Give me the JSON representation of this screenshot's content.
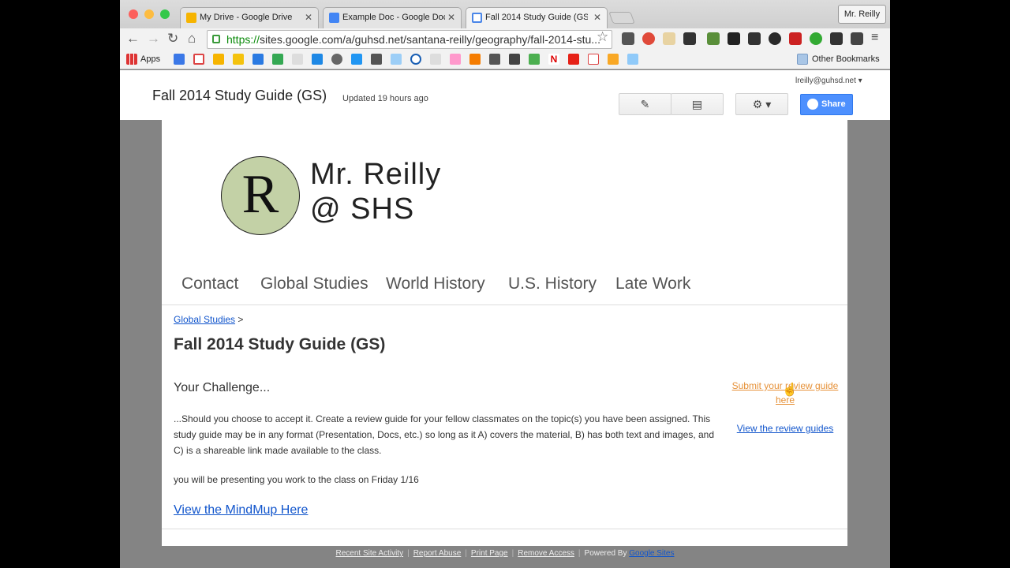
{
  "browser": {
    "tabs": [
      {
        "title": "My Drive - Google Drive",
        "icon": "google-drive-icon",
        "color": "#f6b400"
      },
      {
        "title": "Example Doc - Google Docs",
        "icon": "google-docs-icon",
        "color": "#4285f4"
      },
      {
        "title": "Fall 2014 Study Guide (GS)",
        "icon": "google-sites-icon",
        "color": "#4a86e8"
      }
    ],
    "profile_label": "Mr. Reilly",
    "url_scheme": "https://",
    "url_rest": "sites.google.com/a/guhsd.net/santana-reilly/geography/fall-2014-stu...",
    "bookmarks": {
      "apps_label": "Apps",
      "other_label": "Other Bookmarks"
    }
  },
  "site_header": {
    "title": "Fall 2014 Study Guide (GS)",
    "updated": "Updated 19 hours ago",
    "account": "lreilly@guhsd.net",
    "share_label": "Share",
    "share_color": "#4d90fe"
  },
  "logo": {
    "letter": "R",
    "line1": "Mr. Reilly",
    "line2": "@ SHS",
    "circle_color": "#c3d1a6"
  },
  "nav": [
    "Contact",
    "Global Studies",
    "World History",
    "U.S. History",
    "Late Work"
  ],
  "content": {
    "breadcrumb_link": "Global Studies",
    "breadcrumb_sep": ">",
    "heading": "Fall 2014 Study Guide (GS)",
    "challenge": "Your Challenge...",
    "paragraph": "...Should you choose to accept it. Create a review guide for your fellow classmates on the topic(s) you have been assigned. This study guide may be in any format (Presentation, Docs, etc.) so long as it A) covers the material, B) has both text and images, and C) is a shareable link made available to the class.",
    "presenting": "you will be presenting you work to the class on Friday 1/16",
    "mindmup_link": "View the MindMup Here",
    "submit_link": "Submit your review guide here",
    "view_guides_link": "View the review guides",
    "link_color": "#1155cc",
    "submit_color": "#e69138"
  },
  "footer": {
    "links": [
      "Recent Site Activity",
      "Report Abuse",
      "Print Page",
      "Remove Access"
    ],
    "powered_by": "Powered By",
    "google_sites": "Google Sites"
  }
}
